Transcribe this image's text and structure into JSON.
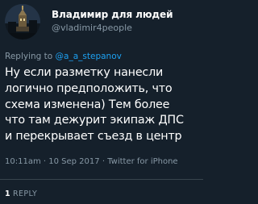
{
  "tweet": {
    "author": {
      "name": "Владимир для людей",
      "handle": "@vladimir4people",
      "avatar_icon": "city-photo-avatar"
    },
    "reply_prefix": "Replying to ",
    "reply_to": "@a_a_stepanov",
    "text_lines": [
      "Ну если разметку нанесли",
      "логично предположить, что",
      "схема изменена) Тем более",
      "что там дежурит экипаж ДПС",
      "и перекрывает съезд в центр"
    ],
    "time": "10:11am",
    "separator_1": "·",
    "date": "10 Sep 2017",
    "separator_2": "·",
    "source": "Twitter for iPhone",
    "reply_count": "1",
    "reply_label": "REPLY"
  },
  "colors": {
    "background": "#15202b",
    "text": "#ffffff",
    "secondary_text": "#8899a6",
    "link": "#1da1f2",
    "divider": "#38444d"
  }
}
